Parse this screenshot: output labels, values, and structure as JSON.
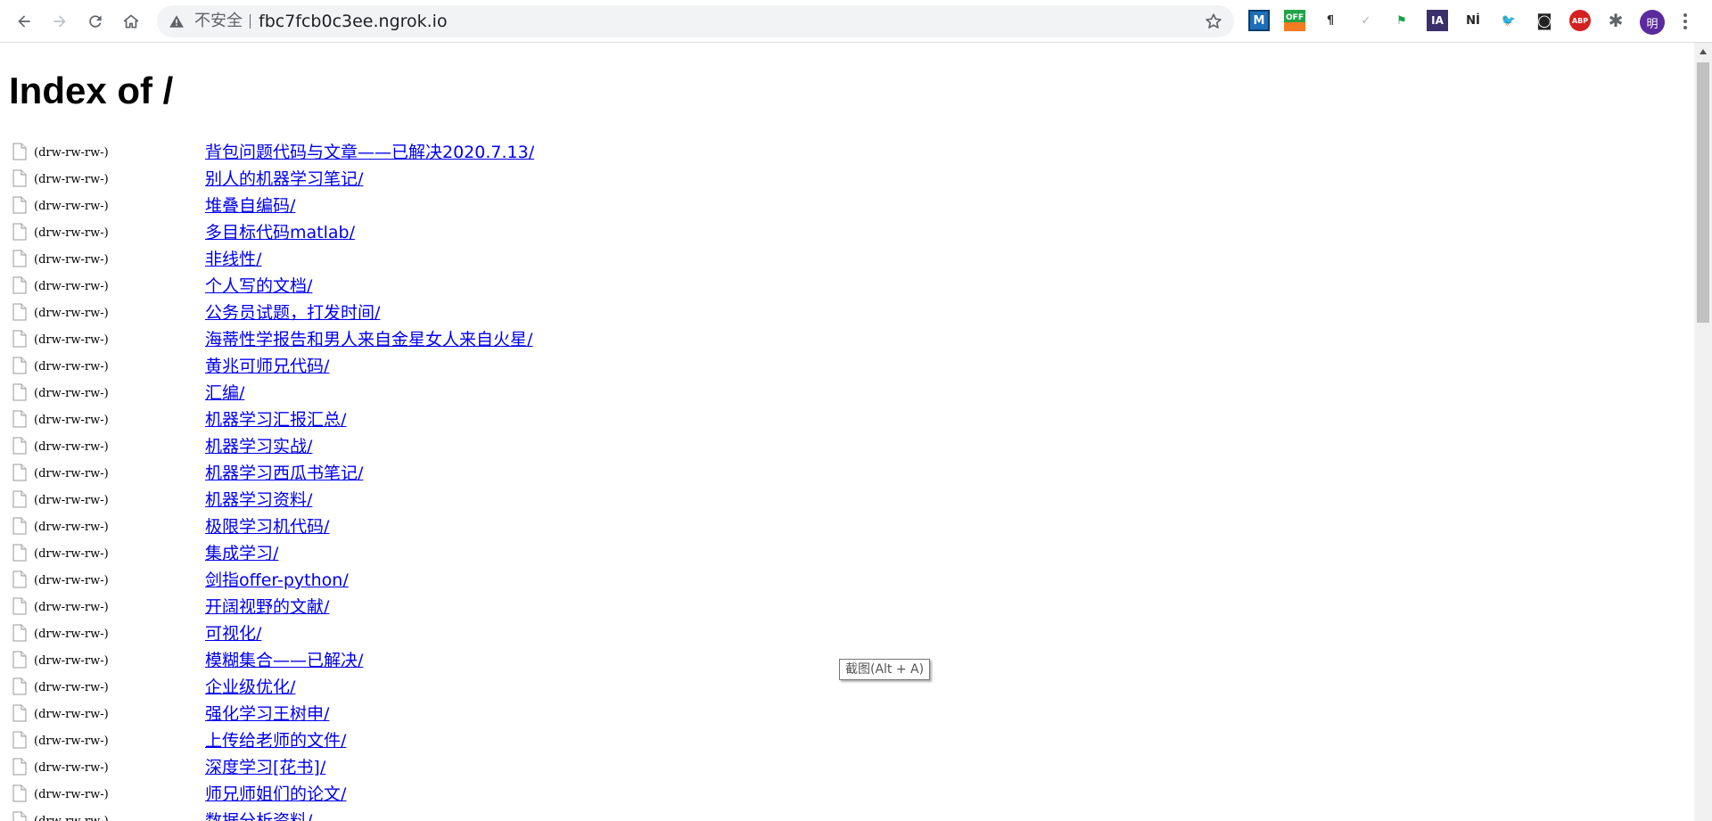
{
  "browser": {
    "security_label": "不安全",
    "url": "fbc7fcb0c3ee.ngrok.io",
    "extensions": [
      {
        "name": "M",
        "label": "M",
        "color": "#1e6fb8"
      },
      {
        "name": "off",
        "label": "OFF",
        "color": "#f47b20"
      },
      {
        "name": "pilcrow",
        "label": "¶",
        "color": "#333333"
      },
      {
        "name": "check",
        "label": "✓",
        "color": "#aaaaaa"
      },
      {
        "name": "flag",
        "label": "⚑",
        "color": "#16a34a"
      },
      {
        "name": "ia",
        "label": "IA",
        "color": "#3b2f6b"
      },
      {
        "name": "ni",
        "label": "Nİ",
        "color": "#222222"
      },
      {
        "name": "bird",
        "label": "🐦",
        "color": "#222222"
      },
      {
        "name": "glasses",
        "label": "◙",
        "color": "#222222"
      },
      {
        "name": "abp",
        "label": "ABP",
        "color": "#d42020"
      },
      {
        "name": "puzzle",
        "label": "✱",
        "color": "#5f6368"
      }
    ],
    "avatar_text": "明"
  },
  "page": {
    "heading": "Index of /",
    "entries": [
      {
        "perm": "(drw-rw-rw-)",
        "name": "背包问题代码与文章——已解决2020.7.13/"
      },
      {
        "perm": "(drw-rw-rw-)",
        "name": "别人的机器学习笔记/"
      },
      {
        "perm": "(drw-rw-rw-)",
        "name": "堆叠自编码/"
      },
      {
        "perm": "(drw-rw-rw-)",
        "name": "多目标代码matlab/"
      },
      {
        "perm": "(drw-rw-rw-)",
        "name": "非线性/"
      },
      {
        "perm": "(drw-rw-rw-)",
        "name": "个人写的文档/"
      },
      {
        "perm": "(drw-rw-rw-)",
        "name": "公务员试题，打发时间/"
      },
      {
        "perm": "(drw-rw-rw-)",
        "name": "海蒂性学报告和男人来自金星女人来自火星/"
      },
      {
        "perm": "(drw-rw-rw-)",
        "name": "黄兆可师兄代码/"
      },
      {
        "perm": "(drw-rw-rw-)",
        "name": "汇编/"
      },
      {
        "perm": "(drw-rw-rw-)",
        "name": "机器学习汇报汇总/"
      },
      {
        "perm": "(drw-rw-rw-)",
        "name": "机器学习实战/"
      },
      {
        "perm": "(drw-rw-rw-)",
        "name": "机器学习西瓜书笔记/"
      },
      {
        "perm": "(drw-rw-rw-)",
        "name": "机器学习资料/"
      },
      {
        "perm": "(drw-rw-rw-)",
        "name": "极限学习机代码/"
      },
      {
        "perm": "(drw-rw-rw-)",
        "name": "集成学习/"
      },
      {
        "perm": "(drw-rw-rw-)",
        "name": "剑指offer-python/"
      },
      {
        "perm": "(drw-rw-rw-)",
        "name": "开阔视野的文献/"
      },
      {
        "perm": "(drw-rw-rw-)",
        "name": "可视化/"
      },
      {
        "perm": "(drw-rw-rw-)",
        "name": "模糊集合——已解决/"
      },
      {
        "perm": "(drw-rw-rw-)",
        "name": "企业级优化/"
      },
      {
        "perm": "(drw-rw-rw-)",
        "name": "强化学习王树申/"
      },
      {
        "perm": "(drw-rw-rw-)",
        "name": "上传给老师的文件/"
      },
      {
        "perm": "(drw-rw-rw-)",
        "name": "深度学习[花书]/"
      },
      {
        "perm": "(drw-rw-rw-)",
        "name": "师兄师姐们的论文/"
      },
      {
        "perm": "(drw-rw-rw-)",
        "name": "数据分析资料/"
      }
    ]
  },
  "tooltip": {
    "text": "截图(Alt + A)"
  }
}
